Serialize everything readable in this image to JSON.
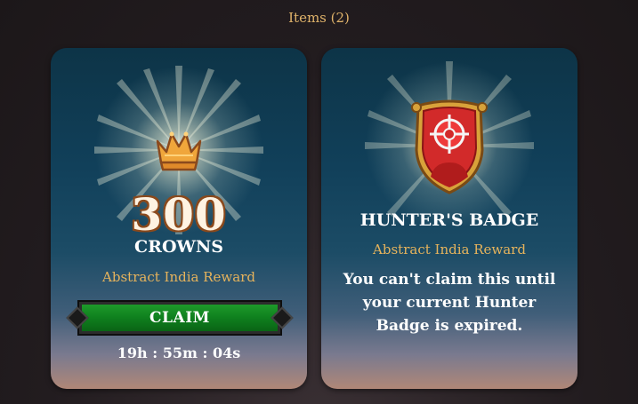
{
  "header": {
    "title": "Items (2)"
  },
  "cards": [
    {
      "icon": "crown-icon",
      "amount": "300",
      "label": "CROWNS",
      "reward_source": "Abstract India Reward",
      "claim_label": "CLAIM",
      "timer": "19h : 55m : 04s"
    },
    {
      "icon": "hunter-badge-icon",
      "title": "HUNTER'S BADGE",
      "reward_source": "Abstract India Reward",
      "message": "You can't claim this until your current Hunter Badge is expired."
    }
  ],
  "colors": {
    "accent_gold": "#e6b35c",
    "claim_green": "#0f7f1e",
    "card_bg": "#11405a"
  }
}
